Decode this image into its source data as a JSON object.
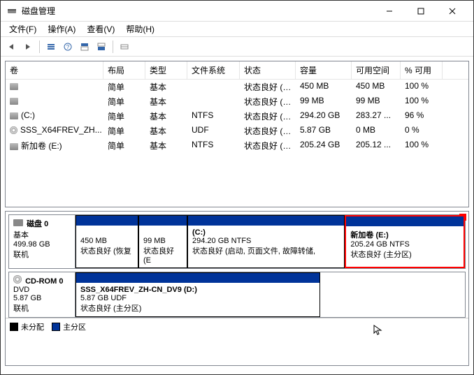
{
  "window": {
    "title": "磁盘管理"
  },
  "menus": {
    "file": "文件(F)",
    "action": "操作(A)",
    "view": "查看(V)",
    "help": "帮助(H)"
  },
  "columns": {
    "volume": "卷",
    "layout": "布局",
    "type": "类型",
    "fs": "文件系统",
    "status": "状态",
    "capacity": "容量",
    "free": "可用空间",
    "pct": "% 可用"
  },
  "volumes": [
    {
      "icon": "disk",
      "name": "",
      "layout": "简单",
      "type": "基本",
      "fs": "",
      "status": "状态良好 (…",
      "cap": "450 MB",
      "free": "450 MB",
      "pct": "100 %"
    },
    {
      "icon": "disk",
      "name": "",
      "layout": "简单",
      "type": "基本",
      "fs": "",
      "status": "状态良好 (…",
      "cap": "99 MB",
      "free": "99 MB",
      "pct": "100 %"
    },
    {
      "icon": "disk",
      "name": "(C:)",
      "layout": "简单",
      "type": "基本",
      "fs": "NTFS",
      "status": "状态良好 (…",
      "cap": "294.20 GB",
      "free": "283.27 ...",
      "pct": "96 %"
    },
    {
      "icon": "cd",
      "name": "SSS_X64FREV_ZH...",
      "layout": "简单",
      "type": "基本",
      "fs": "UDF",
      "status": "状态良好 (…",
      "cap": "5.87 GB",
      "free": "0 MB",
      "pct": "0 %"
    },
    {
      "icon": "disk",
      "name": "新加卷 (E:)",
      "layout": "简单",
      "type": "基本",
      "fs": "NTFS",
      "status": "状态良好 (…",
      "cap": "205.24 GB",
      "free": "205.12 ...",
      "pct": "100 %"
    }
  ],
  "disks": {
    "disk0": {
      "label_title": "磁盘 0",
      "label_type": "基本",
      "label_size": "499.98 GB",
      "label_status": "联机",
      "parts": {
        "p1": {
          "title": "",
          "line1": "450 MB",
          "line2": "状态良好 (恢复"
        },
        "p2": {
          "title": "",
          "line1": "99 MB",
          "line2": "状态良好 (E"
        },
        "p3": {
          "title": "(C:)",
          "line1": "294.20 GB NTFS",
          "line2": "状态良好 (启动, 页面文件, 故障转储,"
        },
        "p4": {
          "title": "新加卷   (E:)",
          "line1": "205.24 GB NTFS",
          "line2": "状态良好 (主分区)"
        }
      }
    },
    "cdrom": {
      "label_title": "CD-ROM 0",
      "label_type": "DVD",
      "label_size": "5.87 GB",
      "label_status": "联机",
      "part": {
        "title": "SSS_X64FREV_ZH-CN_DV9 (D:)",
        "line1": "5.87 GB UDF",
        "line2": "状态良好 (主分区)"
      }
    }
  },
  "legend": {
    "unalloc": "未分配",
    "primary": "主分区"
  }
}
